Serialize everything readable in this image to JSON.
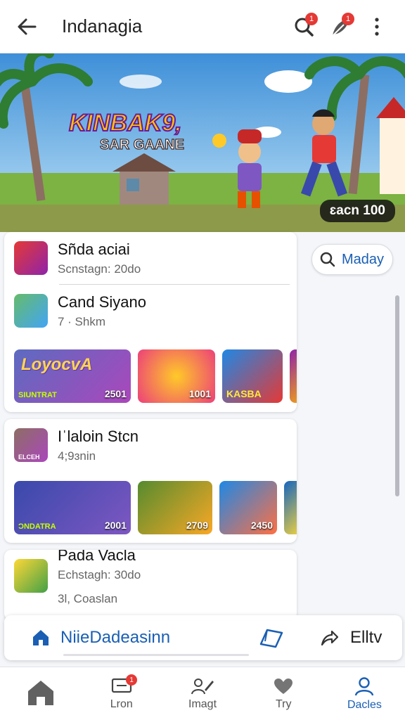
{
  "header": {
    "title": "Indanagia",
    "search_badge": "1",
    "feather_badge": "1"
  },
  "hero": {
    "game_title_line1": "KINBAK9,",
    "game_title_line2": "SAR GAANE",
    "badge": "ɛacn 100"
  },
  "cards": [
    {
      "items": [
        {
          "name": "Sñda aciai",
          "sub": "Scnstagn: 20do"
        },
        {
          "name": "Cand Siyano",
          "sub": "7 · Shkm"
        }
      ],
      "tiles": [
        {
          "title": "LoyocvA",
          "label": "SIUNTRAT",
          "value": "2501"
        },
        {
          "title": "",
          "label": "",
          "value": "1001"
        },
        {
          "title": "",
          "label": "KASBA",
          "value": ""
        }
      ]
    },
    {
      "items": [
        {
          "name": "Iˈlaloin Stcn",
          "sub": "4;9ɜnin",
          "thumb_label": "ELCEH"
        }
      ],
      "tiles": [
        {
          "title": "",
          "label": "ƆNDATRA",
          "value": "2001"
        },
        {
          "title": "",
          "label": "",
          "value": "2709"
        },
        {
          "title": "",
          "label": "",
          "value": "2450"
        }
      ]
    },
    {
      "items": [
        {
          "name": "Pada Vacla",
          "sub": "Echstagh: 30do",
          "extra": "3l, Coaslan"
        }
      ]
    }
  ],
  "side_search": {
    "label": "Maday"
  },
  "quickbar": {
    "home_label": "NiieDadeasinn",
    "share_label": "Elltv"
  },
  "bottom_nav": [
    {
      "label": "",
      "icon": "home-icon"
    },
    {
      "label": "Lron",
      "icon": "inbox-icon",
      "badge": "1"
    },
    {
      "label": "Imagt",
      "icon": "edit-user-icon"
    },
    {
      "label": "Try",
      "icon": "heart-icon"
    },
    {
      "label": "Dacles",
      "icon": "person-icon"
    }
  ],
  "colors": {
    "accent": "#1a5fb4",
    "badge": "#e53935"
  }
}
